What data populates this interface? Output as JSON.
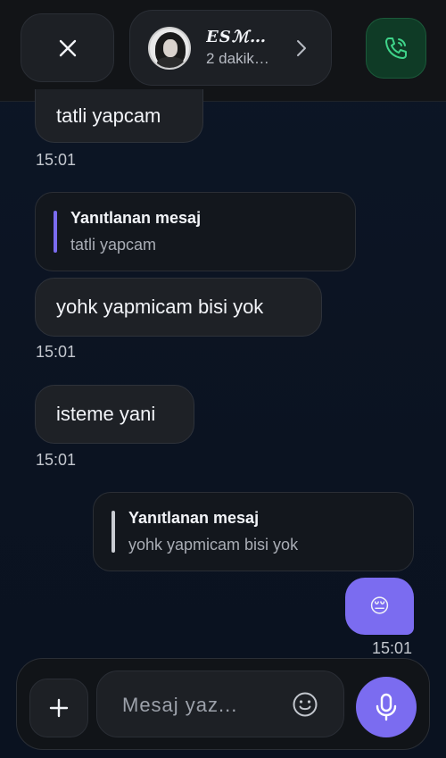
{
  "header": {
    "contact_name": "ESℳ…",
    "contact_status": "2 dakik…",
    "accent_call": "#1b5a3a"
  },
  "messages": [
    {
      "type": "incoming",
      "text": "tatli yapcam",
      "time": "15:01"
    },
    {
      "type": "incoming-reply",
      "reply_title": "Yanıtlanan mesaj",
      "reply_text": "tatli yapcam",
      "text": "yohk yapmicam bisi yok",
      "time": "15:01"
    },
    {
      "type": "incoming",
      "text": "isteme yani",
      "time": "15:01"
    },
    {
      "type": "outgoing-reply",
      "reply_title": "Yanıtlanan mesaj",
      "reply_text": "yohk yapmicam bisi yok",
      "text": "😔",
      "time": "15:01"
    }
  ],
  "composer": {
    "placeholder": "Mesaj yaz..."
  },
  "colors": {
    "accent": "#7b6cf0",
    "incoming_reply_bar": "#7b6cf0",
    "outgoing_reply_bar": "#c9ccd2"
  }
}
